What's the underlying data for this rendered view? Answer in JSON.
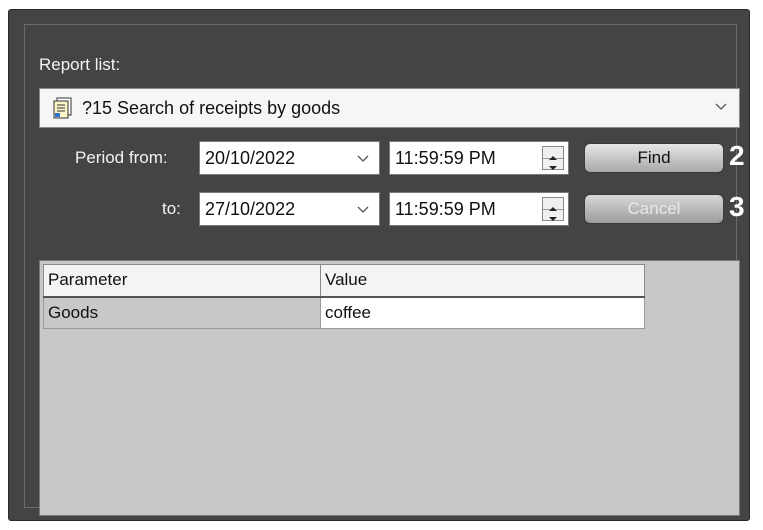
{
  "report_list": {
    "label": "Report list:",
    "selected": "?15 Search of receipts by goods"
  },
  "period": {
    "from_label": "Period from:",
    "to_label": "to:",
    "from_date": "20/10/2022",
    "from_time": "11:59:59 PM",
    "to_date": "27/10/2022",
    "to_time": "11:59:59 PM"
  },
  "buttons": {
    "find_label": "Find",
    "cancel_label": "Cancel",
    "find_callout": "2",
    "cancel_callout": "3"
  },
  "params_table": {
    "headers": [
      "Parameter",
      "Value"
    ],
    "rows": [
      {
        "parameter": "Goods",
        "value": "coffee"
      }
    ]
  },
  "colors": {
    "panel_bg": "#444444",
    "grid_bg": "#c8c8c8"
  }
}
